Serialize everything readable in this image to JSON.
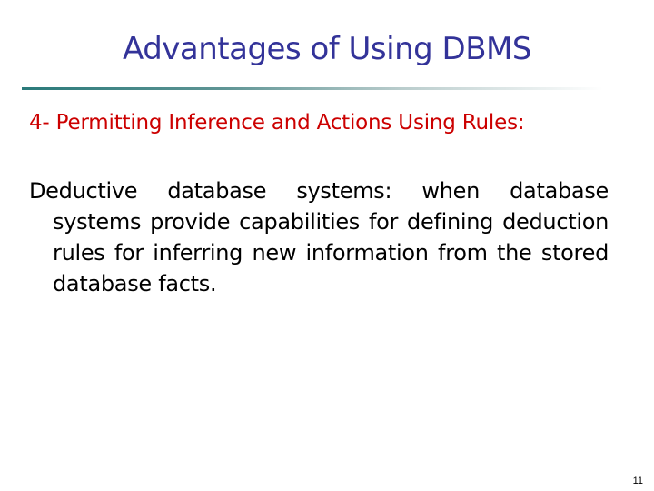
{
  "slide": {
    "title": "Advantages of Using DBMS",
    "subheading": "4- Permitting Inference and Actions Using Rules:",
    "body": "Deductive database systems: when database systems provide capabilities for defining deduction rules for inferring new information from the stored database facts.",
    "page_number": "11"
  },
  "colors": {
    "title": "#333399",
    "subheading": "#cc0000",
    "body": "#000000",
    "rule_start": "#2a7a7a"
  }
}
